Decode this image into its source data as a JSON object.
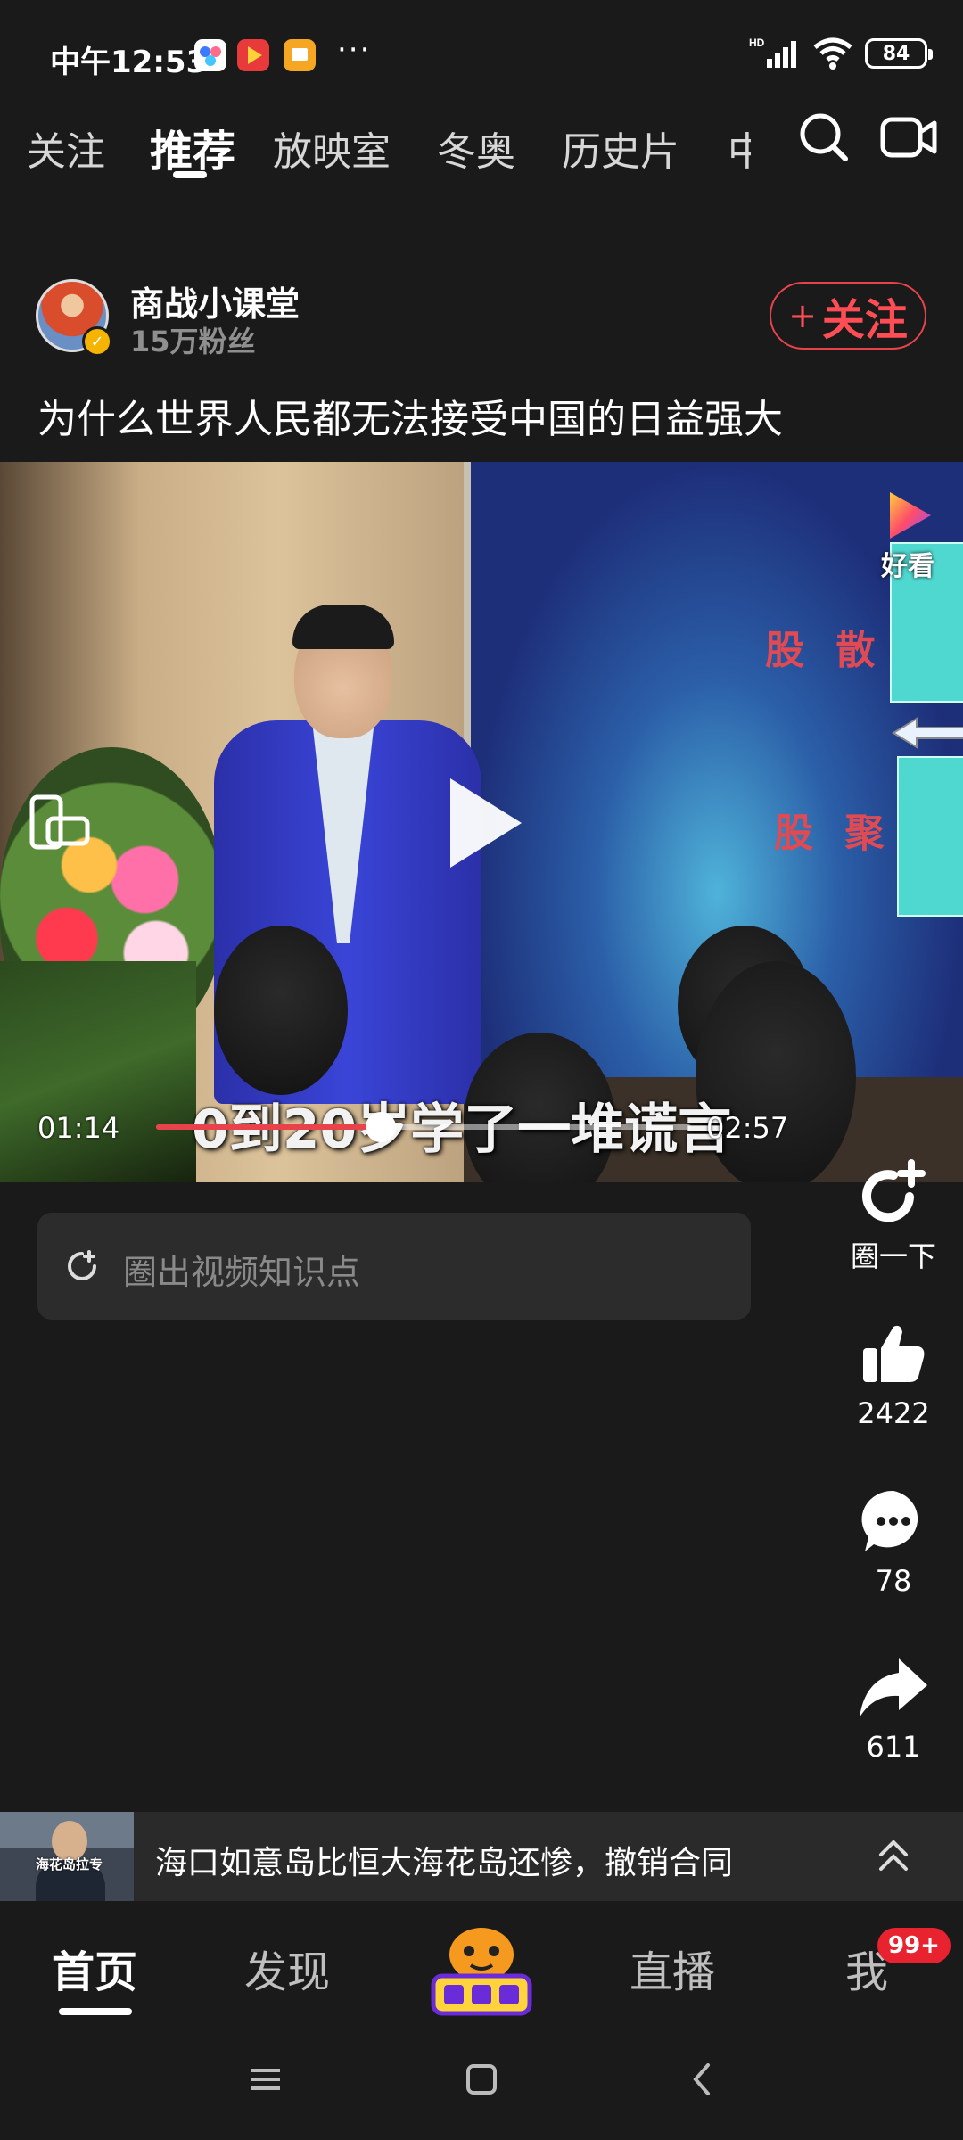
{
  "status_bar": {
    "time": "中午12:53",
    "dots": "···",
    "battery": "84",
    "network_label": "HD"
  },
  "top_tabs": [
    {
      "label": "关注",
      "active": false
    },
    {
      "label": "推荐",
      "active": true
    },
    {
      "label": "放映室",
      "active": false
    },
    {
      "label": "冬奥",
      "active": false
    },
    {
      "label": "历史片",
      "active": false
    },
    {
      "label": "中",
      "active": false
    }
  ],
  "author": {
    "name": "商战小课堂",
    "fans": "15万粉丝",
    "follow_label": "关注",
    "follow_plus": "+"
  },
  "video": {
    "title": "为什么世界人民都无法接受中国的日益强大",
    "subtitle": "0到20岁学了一堆谎言",
    "current_time": "01:14",
    "total_time": "02:57",
    "progress": 0.42,
    "watermark_label": "好看",
    "slide_text_1": "股 散",
    "slide_text_2": "股 聚"
  },
  "knowledge_point": {
    "placeholder": "圈出视频知识点"
  },
  "actions": {
    "circle_label": "圈一下",
    "likes": "2422",
    "comments": "78",
    "shares": "611"
  },
  "news_bar": {
    "text": "海口如意岛比恒大海花岛还惨，撤销合同",
    "thumb_caption": "海花岛拉专"
  },
  "bottom_nav": {
    "home": "首页",
    "discover": "发现",
    "live": "直播",
    "me": "我",
    "me_badge": "99+"
  },
  "colors": {
    "accent_red": "#e8434a",
    "background": "#1a1a1a"
  }
}
